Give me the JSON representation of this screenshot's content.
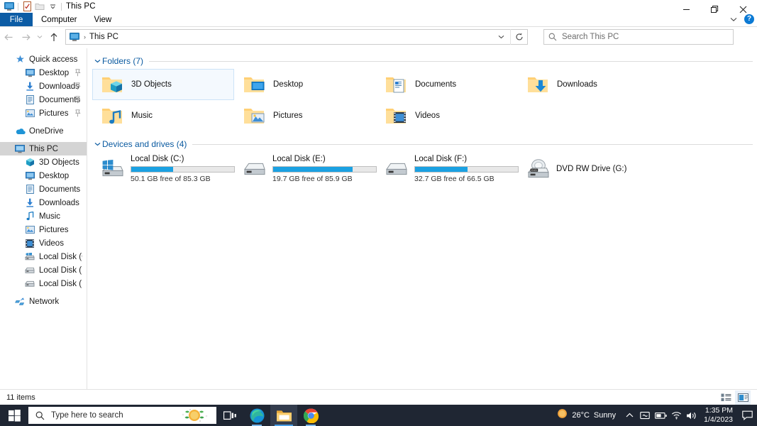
{
  "window": {
    "title": "This PC",
    "quick_access_icons": [
      "this-pc-icon",
      "properties-icon",
      "new-folder-icon",
      "customize-dropdown-icon"
    ],
    "controls": {
      "minimize": "—",
      "restore": "❐",
      "close": "✕",
      "help": "?"
    }
  },
  "ribbon": {
    "tabs": [
      {
        "label": "File",
        "active": true
      },
      {
        "label": "Computer",
        "active": false
      },
      {
        "label": "View",
        "active": false
      }
    ]
  },
  "address": {
    "back_tooltip": "Back",
    "forward_tooltip": "Forward",
    "recent_tooltip": "Recent locations",
    "up_tooltip": "Up",
    "breadcrumb": "This PC",
    "breadcrumb_separator": "›",
    "dropdown_icon": "chevron-down-icon",
    "refresh_icon": "refresh-icon"
  },
  "search": {
    "placeholder": "Search This PC",
    "icon": "search-icon"
  },
  "sidebar": {
    "items": [
      {
        "label": "Quick access",
        "icon": "star-icon",
        "indent": 0,
        "pinned": false,
        "selected": false
      },
      {
        "label": "Desktop",
        "icon": "desktop-icon",
        "indent": 1,
        "pinned": true,
        "selected": false
      },
      {
        "label": "Downloads",
        "icon": "downloads-icon",
        "indent": 1,
        "pinned": true,
        "selected": false
      },
      {
        "label": "Documents",
        "icon": "documents-icon",
        "indent": 1,
        "pinned": true,
        "selected": false
      },
      {
        "label": "Pictures",
        "icon": "pictures-icon",
        "indent": 1,
        "pinned": true,
        "selected": false
      },
      {
        "label": "OneDrive",
        "icon": "onedrive-icon",
        "indent": 0,
        "pinned": false,
        "selected": false
      },
      {
        "label": "This PC",
        "icon": "this-pc-icon",
        "indent": 0,
        "pinned": false,
        "selected": true
      },
      {
        "label": "3D Objects",
        "icon": "3d-objects-icon",
        "indent": 1,
        "pinned": false,
        "selected": false
      },
      {
        "label": "Desktop",
        "icon": "desktop-icon",
        "indent": 1,
        "pinned": false,
        "selected": false
      },
      {
        "label": "Documents",
        "icon": "documents-icon",
        "indent": 1,
        "pinned": false,
        "selected": false
      },
      {
        "label": "Downloads",
        "icon": "downloads-icon",
        "indent": 1,
        "pinned": false,
        "selected": false
      },
      {
        "label": "Music",
        "icon": "music-icon",
        "indent": 1,
        "pinned": false,
        "selected": false
      },
      {
        "label": "Pictures",
        "icon": "pictures-icon",
        "indent": 1,
        "pinned": false,
        "selected": false
      },
      {
        "label": "Videos",
        "icon": "videos-icon",
        "indent": 1,
        "pinned": false,
        "selected": false
      },
      {
        "label": "Local Disk (C:)",
        "icon": "windows-drive-icon",
        "indent": 1,
        "pinned": false,
        "selected": false
      },
      {
        "label": "Local Disk (E:)",
        "icon": "drive-icon",
        "indent": 1,
        "pinned": false,
        "selected": false
      },
      {
        "label": "Local Disk (F:)",
        "icon": "drive-icon",
        "indent": 1,
        "pinned": false,
        "selected": false
      },
      {
        "label": "Network",
        "icon": "network-icon",
        "indent": 0,
        "pinned": false,
        "selected": false
      }
    ]
  },
  "main": {
    "groups": [
      {
        "title": "Folders (7)",
        "expanded": true
      },
      {
        "title": "Devices and drives (4)",
        "expanded": true
      }
    ],
    "folders": [
      {
        "label": "3D Objects",
        "icon": "folder-3d-objects-icon",
        "selected": true
      },
      {
        "label": "Desktop",
        "icon": "folder-desktop-icon",
        "selected": false
      },
      {
        "label": "Documents",
        "icon": "folder-documents-icon",
        "selected": false
      },
      {
        "label": "Downloads",
        "icon": "folder-downloads-icon",
        "selected": false
      },
      {
        "label": "Music",
        "icon": "folder-music-icon",
        "selected": false
      },
      {
        "label": "Pictures",
        "icon": "folder-pictures-icon",
        "selected": false
      },
      {
        "label": "Videos",
        "icon": "folder-videos-icon",
        "selected": false
      }
    ],
    "drives": [
      {
        "label": "Local Disk (C:)",
        "icon": "windows-drive-icon",
        "has_bar": true,
        "used_percent": 41,
        "capacity_text": "50.1 GB free of 85.3 GB",
        "free": "50.1 GB",
        "total": "85.3 GB"
      },
      {
        "label": "Local Disk (E:)",
        "icon": "drive-icon",
        "has_bar": true,
        "used_percent": 77,
        "capacity_text": "19.7 GB free of 85.9 GB",
        "free": "19.7 GB",
        "total": "85.9 GB"
      },
      {
        "label": "Local Disk (F:)",
        "icon": "drive-icon",
        "has_bar": true,
        "used_percent": 51,
        "capacity_text": "32.7 GB free of 66.5 GB",
        "free": "32.7 GB",
        "total": "66.5 GB"
      },
      {
        "label": "DVD RW Drive (G:)",
        "icon": "dvd-drive-icon",
        "has_bar": false,
        "used_percent": 0,
        "capacity_text": "",
        "free": "",
        "total": ""
      }
    ]
  },
  "status": {
    "item_count": "11 items",
    "view_details_icon": "details-view-icon",
    "view_large_icons_icon": "large-icons-view-icon"
  },
  "taskbar": {
    "start_icon": "windows-start-icon",
    "search_placeholder": "Type here to search",
    "cortana_icon": "cortana-sun-icon",
    "items": [
      {
        "name": "task-view-icon",
        "active": false,
        "running": false
      },
      {
        "name": "edge-icon",
        "active": false,
        "running": true
      },
      {
        "name": "file-explorer-icon",
        "active": true,
        "running": false
      },
      {
        "name": "chrome-icon",
        "active": false,
        "running": true
      }
    ],
    "weather": {
      "temperature": "26°C",
      "condition": "Sunny",
      "icon": "sun-icon"
    },
    "tray_icons": [
      "chevron-up-icon",
      "onedrive-tray-icon",
      "battery-icon",
      "wifi-icon",
      "volume-icon"
    ],
    "clock": {
      "time": "1:35 PM",
      "date": "1/4/2023"
    },
    "action_center_icon": "action-center-icon"
  },
  "colors": {
    "accent": "#0c5ca5",
    "link": "#0a5aa0",
    "bar_fill": "#1ba1e2",
    "taskbar_bg": "#1f2633",
    "folder": "#ffd075"
  }
}
